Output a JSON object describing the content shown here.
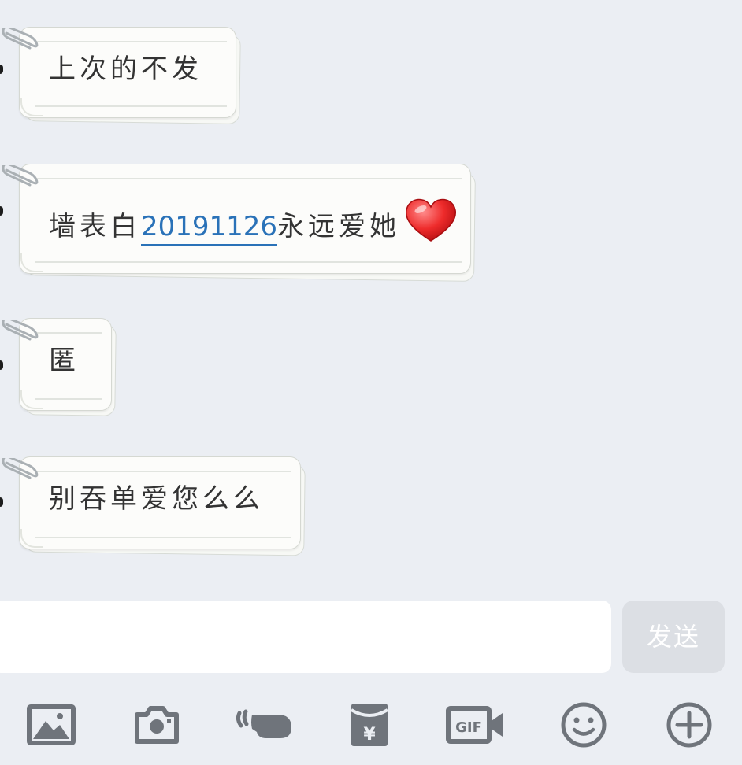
{
  "messages": [
    {
      "text": "上次的不发"
    },
    {
      "text_before": "墙表白",
      "link": "20191126",
      "text_after": "永远爱她",
      "emoji": "heart-icon"
    },
    {
      "text": "匿"
    },
    {
      "text": "别吞单爱您么么"
    }
  ],
  "input": {
    "value": "",
    "placeholder": ""
  },
  "send_label": "发送",
  "toolbar": {
    "icons": [
      "image-icon",
      "camera-icon",
      "poke-hand-icon",
      "red-packet-icon",
      "gif-icon",
      "emoji-smile-icon",
      "plus-icon"
    ],
    "red_packet_symbol": "¥",
    "gif_label": "GIF"
  },
  "colors": {
    "background": "#ebeef3",
    "bubble": "#fcfcfa",
    "link": "#2a72b8",
    "send_disabled": "#dcdfe4",
    "icon": "#6f747b"
  }
}
